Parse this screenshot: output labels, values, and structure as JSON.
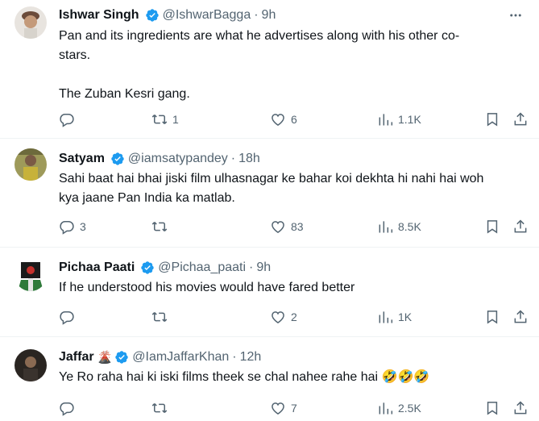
{
  "tweets": [
    {
      "name": "Ishwar Singh",
      "emoji": "",
      "handle": "@IshwarBagga",
      "sep": "·",
      "time": "9h",
      "text": "Pan and its ingredients are what he advertises along with his other co-\nstars.\n\nThe Zuban Kesri gang.",
      "replies": "",
      "reposts": "1",
      "likes": "6",
      "views": "1.1K"
    },
    {
      "name": "Satyam",
      "emoji": "",
      "handle": "@iamsatypandey",
      "sep": "·",
      "time": "18h",
      "text": "Sahi baat hai bhai jiski film ulhasnagar ke bahar koi dekhta hi nahi hai woh\nkya jaane Pan India ka matlab.",
      "replies": "3",
      "reposts": "",
      "likes": "83",
      "views": "8.5K"
    },
    {
      "name": "Pichaa Paati",
      "emoji": "",
      "handle": "@Pichaa_paati",
      "sep": "·",
      "time": "9h",
      "text": "If he understood his movies would have fared better",
      "replies": "",
      "reposts": "",
      "likes": "2",
      "views": "1K"
    },
    {
      "name": "Jaffar",
      "emoji": "🌋",
      "handle": "@IamJaffarKhan",
      "sep": "·",
      "time": "12h",
      "text": "Ye Ro raha hai ki iski films theek se chal nahee rahe hai 🤣🤣🤣",
      "replies": "",
      "reposts": "",
      "likes": "7",
      "views": "2.5K"
    }
  ],
  "colors": {
    "verified": "#1d9bf0",
    "muted": "#536471",
    "text": "#0f1419",
    "divider": "#eff3f4"
  },
  "icons": [
    "more-icon",
    "verified-badge-icon",
    "reply-icon",
    "repost-icon",
    "like-icon",
    "views-icon",
    "bookmark-icon",
    "share-icon"
  ]
}
